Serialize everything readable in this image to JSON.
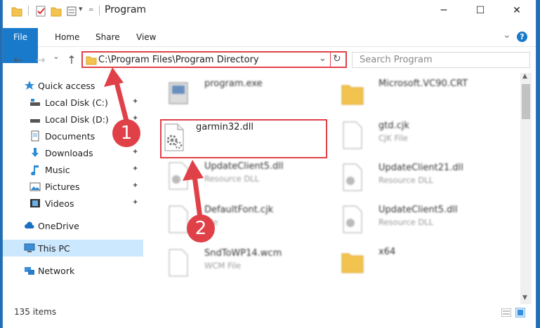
{
  "window": {
    "title": "Program",
    "minimize": "─",
    "maximize": "☐",
    "close": "✕"
  },
  "ribbon": {
    "tabs": [
      "File",
      "Home",
      "Share",
      "View"
    ],
    "expand": "⌄",
    "help": "?"
  },
  "nav": {
    "back": "←",
    "forward": "→",
    "recent": "⌄",
    "up": "↑",
    "address": "C:\\Program Files\\Program Directory",
    "address_dropdown": "⌄",
    "refresh": "↻",
    "search_placeholder": "Search Program"
  },
  "sidebar": {
    "items": [
      {
        "label": "Quick access",
        "icon": "star-icon",
        "pinned": false
      },
      {
        "label": "Local Disk (C:)",
        "icon": "drive-icon",
        "pinned": true
      },
      {
        "label": "Local Disk (D:)",
        "icon": "drive-icon",
        "pinned": true
      },
      {
        "label": "Documents",
        "icon": "documents-icon",
        "pinned": true
      },
      {
        "label": "Downloads",
        "icon": "download-icon",
        "pinned": true
      },
      {
        "label": "Music",
        "icon": "music-icon",
        "pinned": true
      },
      {
        "label": "Pictures",
        "icon": "pictures-icon",
        "pinned": true
      },
      {
        "label": "Videos",
        "icon": "videos-icon",
        "pinned": true
      },
      {
        "label": "OneDrive",
        "icon": "cloud-icon",
        "pinned": false
      },
      {
        "label": "This PC",
        "icon": "computer-icon",
        "pinned": false,
        "selected": true
      },
      {
        "label": "Network",
        "icon": "network-icon",
        "pinned": false
      }
    ],
    "pin_glyph": "📌"
  },
  "files": {
    "left": [
      {
        "name": "program.exe",
        "type": "",
        "icon": "exe-icon"
      },
      {
        "name": "garmin32.dll",
        "type": "",
        "icon": "dll-icon",
        "highlighted": true
      },
      {
        "name": "UpdateClient5.dll",
        "type": "Resource DLL",
        "icon": "dll-icon"
      },
      {
        "name": "DefaultFont.cjk",
        "type": "File",
        "icon": "file-icon"
      },
      {
        "name": "SndToWP14.wcm",
        "type": "WCM File",
        "icon": "file-icon"
      }
    ],
    "right": [
      {
        "name": "Microsoft.VC90.CRT",
        "type": "",
        "icon": "folder-icon"
      },
      {
        "name": "gtd.cjk",
        "type": "CJK File",
        "icon": "file-icon"
      },
      {
        "name": "UpdateClient21.dll",
        "type": "Resource DLL",
        "icon": "dll-icon"
      },
      {
        "name": "UpdateClient5.dll",
        "type": "Resource DLL",
        "icon": "dll-icon"
      },
      {
        "name": "x64",
        "type": "",
        "icon": "folder-icon"
      }
    ]
  },
  "status": {
    "items": "135 items"
  },
  "annotations": {
    "step1": "1",
    "step2": "2"
  },
  "colors": {
    "accent": "#1979ca",
    "highlight": "#e04148",
    "selected": "#cce8ff"
  }
}
